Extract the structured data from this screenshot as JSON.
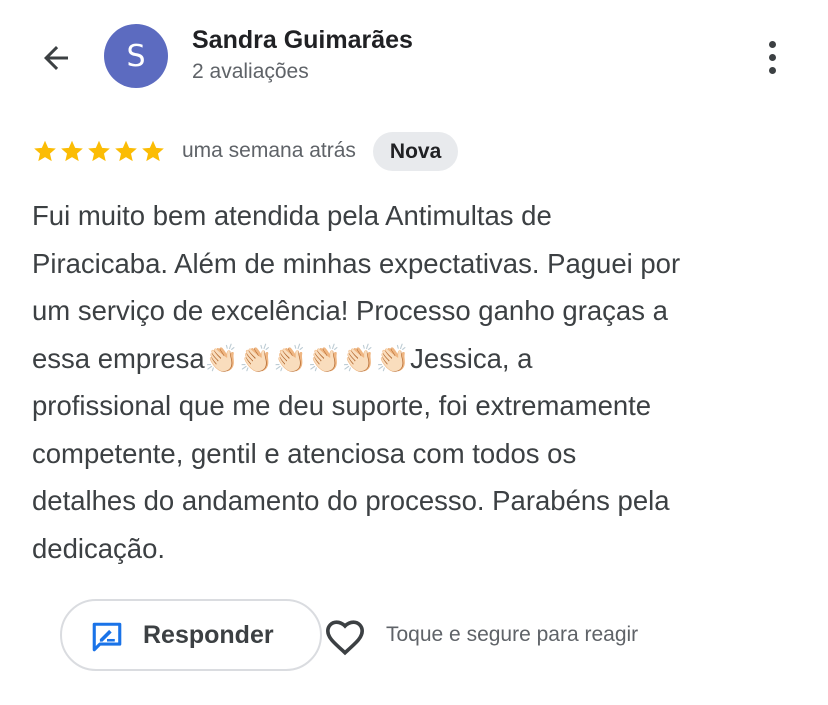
{
  "header": {
    "back_icon": "arrow-back-icon",
    "avatar_letter": "S",
    "avatar_color": "#5c6bc0",
    "user_name": "Sandra Guimarães",
    "user_reviews": "2 avaliações",
    "more_icon": "more-vert-icon"
  },
  "review": {
    "rating": 5,
    "max_rating": 5,
    "star_color": "#fbbc04",
    "date": "uma semana atrás",
    "badge": "Nova",
    "text": "Fui muito bem atendida pela Antimultas de\nPiracicaba. Além de minhas expectativas. Paguei por\num serviço de excelência! Processo ganho graças a\nessa empresa👏🏻👏🏻👏🏻👏🏻👏🏻👏🏻Jessica, a\nprofissional que me deu suporte, foi extremamente\ncompetente, gentil e atenciosa com todos os\ndetalhes do andamento do processo. Parabéns pela\ndedicação."
  },
  "actions": {
    "reply_icon": "reply-edit-icon",
    "reply_label": "Responder",
    "react_icon": "heart-icon",
    "react_hint": "Toque e segure para reagir",
    "accent_color": "#1a73e8"
  }
}
